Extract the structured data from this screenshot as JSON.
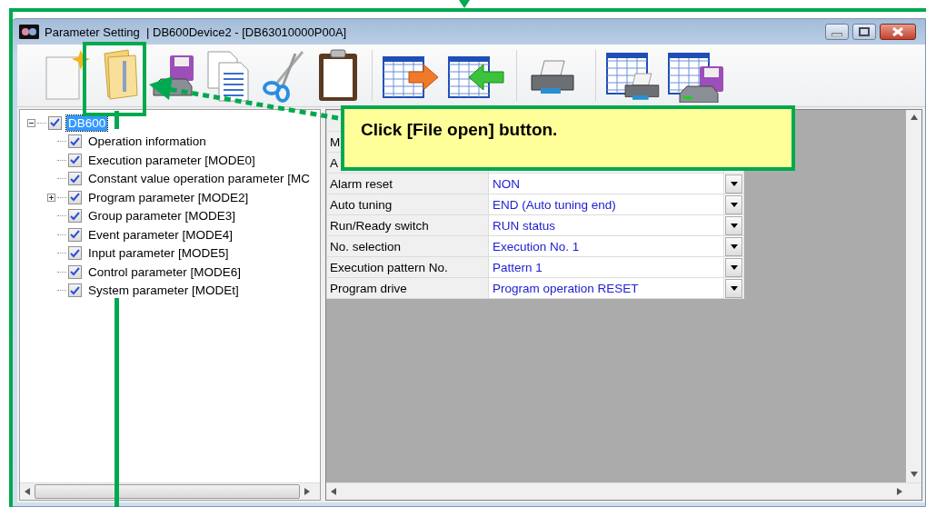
{
  "window": {
    "title": "Parameter Setting  | DB600Device2 - [DB63010000P00A]"
  },
  "toolbar": {
    "buttons": [
      {
        "kind": "new"
      },
      {
        "kind": "open"
      },
      {
        "kind": "save"
      },
      {
        "kind": "copy"
      },
      {
        "kind": "cut"
      },
      {
        "kind": "paste"
      },
      {
        "kind": "separator"
      },
      {
        "kind": "table-export"
      },
      {
        "kind": "table-import"
      },
      {
        "kind": "separator"
      },
      {
        "kind": "print"
      },
      {
        "kind": "separator"
      },
      {
        "kind": "table-print"
      },
      {
        "kind": "table-save"
      }
    ]
  },
  "tree": {
    "items": [
      {
        "label": "DB600",
        "checked": true,
        "selected": true,
        "expanded": true,
        "children": [
          {
            "label": "Operation information",
            "checked": true,
            "selected": false,
            "kind": "leaf"
          },
          {
            "label": "Execution parameter [MODE0]",
            "checked": true,
            "selected": false,
            "kind": "leaf"
          },
          {
            "label": "Constant value operation parameter [MC",
            "checked": true,
            "selected": false,
            "kind": "leaf"
          },
          {
            "label": "Program parameter [MODE2]",
            "checked": true,
            "selected": false,
            "kind": "group",
            "expanded": false
          },
          {
            "label": "Group parameter [MODE3]",
            "checked": true,
            "selected": false,
            "kind": "leaf"
          },
          {
            "label": "Event parameter [MODE4]",
            "checked": true,
            "selected": false,
            "kind": "leaf"
          },
          {
            "label": "Input parameter [MODE5]",
            "checked": true,
            "selected": false,
            "kind": "leaf"
          },
          {
            "label": "Control parameter [MODE6]",
            "checked": true,
            "selected": false,
            "kind": "leaf"
          },
          {
            "label": "System parameter [MODEt]",
            "checked": true,
            "selected": false,
            "kind": "leaf"
          }
        ]
      }
    ]
  },
  "grid": {
    "rows": [
      {
        "label": "M"
      },
      {
        "label": "A"
      },
      {
        "label": "Alarm reset",
        "value": "NON"
      },
      {
        "label": "Auto tuning",
        "value": "END (Auto tuning end)"
      },
      {
        "label": "Run/Ready switch",
        "value": "RUN status"
      },
      {
        "label": "No. selection",
        "value": "Execution No. 1"
      },
      {
        "label": "Execution pattern No.",
        "value": "Pattern 1"
      },
      {
        "label": "Program drive",
        "value": "Program operation RESET"
      }
    ]
  },
  "annotation": {
    "callout": "Click [File open] button."
  }
}
